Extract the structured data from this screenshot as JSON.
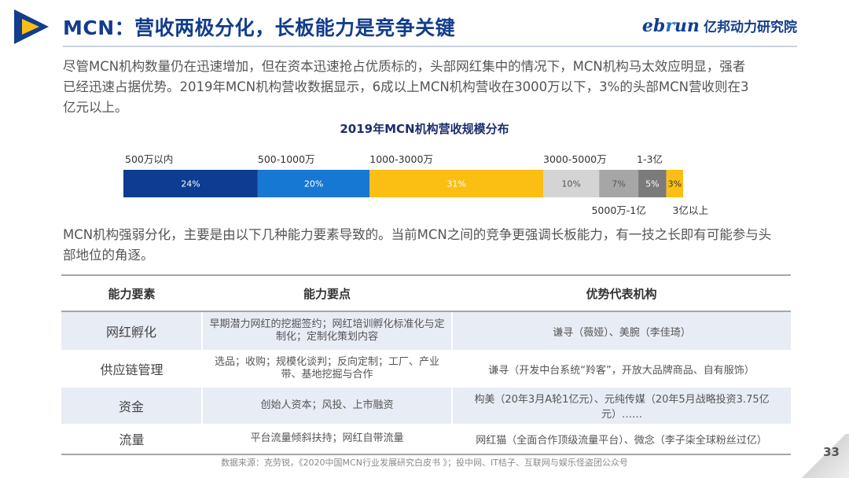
{
  "header": {
    "title": "MCN：营收两极分化，长板能力是竞争关键",
    "brand_en_prefix": "eb",
    "brand_en_r": "r",
    "brand_en_suffix": "un",
    "brand_cn": "亿邦动力研究院"
  },
  "intro": "尽管MCN机构数量仍在迅速增加，但在资本迅速抢占优质标的，头部网红集中的情况下，MCN机构马太效应明显，强者已经迅速占据优势。2019年MCN机构营收数据显示，6成以上MCN机构营收在3000万以下，3%的头部MCN营收则在3亿元以上。",
  "chart_data": {
    "type": "bar",
    "orientation": "horizontal-stacked-100",
    "title": "2019年MCN机构营收规模分布",
    "categories": [
      "500万以内",
      "500-1000万",
      "1000-3000万",
      "3000-5000万",
      "5000万-1亿",
      "1-3亿",
      "3亿以上"
    ],
    "values": [
      24,
      20,
      31,
      10,
      7,
      5,
      3
    ],
    "value_labels": [
      "24%",
      "20%",
      "31%",
      "10%",
      "7%",
      "5%",
      "3%"
    ],
    "label_positions": [
      "top",
      "top",
      "top",
      "top",
      "bottom",
      "top",
      "bottom"
    ],
    "colors": [
      "#0d3c91",
      "#1778d4",
      "#fbbf14",
      "#d4d4d4",
      "#a6a6a6",
      "#7b7b7b",
      "#fbbf14"
    ],
    "text_colors": [
      "#ffffff",
      "#ffffff",
      "#ffffff",
      "#555555",
      "#555555",
      "#ffffff",
      "#333333"
    ]
  },
  "para2": "MCN机构强弱分化，主要是由以下几种能力要素导致的。当前MCN之间的竞争更强调长板能力，有一技之长即有可能参与头部地位的角逐。",
  "table": {
    "headers": [
      "能力要素",
      "能力要点",
      "优势代表机构"
    ],
    "rows": [
      [
        "网红孵化",
        "早期潜力网红的挖掘签约；网红培训孵化标准化与定制化；定制化策划内容",
        "谦寻（薇娅）、美腕（李佳琦）"
      ],
      [
        "供应链管理",
        "选品；收购；规模化谈判；反向定制；工厂、产业带、基地挖掘与合作",
        "谦寻（开发中台系统“羚客”，开放大品牌商品、自有服饰）"
      ],
      [
        "资金",
        "创始人资本；风投、上市融资",
        "构美（20年3月A轮1亿元）、元纯传媒（20年5月战略投资3.75亿元）……"
      ],
      [
        "流量",
        "平台流量倾斜扶持；网红自带流量",
        "网红猫（全面合作顶级流量平台）、微念（李子柒全球粉丝过亿）"
      ]
    ]
  },
  "source": "数据来源：克劳锐，《2020中国MCN行业发展研究白皮书 》；投中网、IT桔子、互联网与娱乐怪盗团公众号",
  "page_number": "33",
  "colors": {
    "primary": "#123d8c",
    "accent_blue": "#1778d4",
    "accent_yellow": "#fbbf14"
  }
}
